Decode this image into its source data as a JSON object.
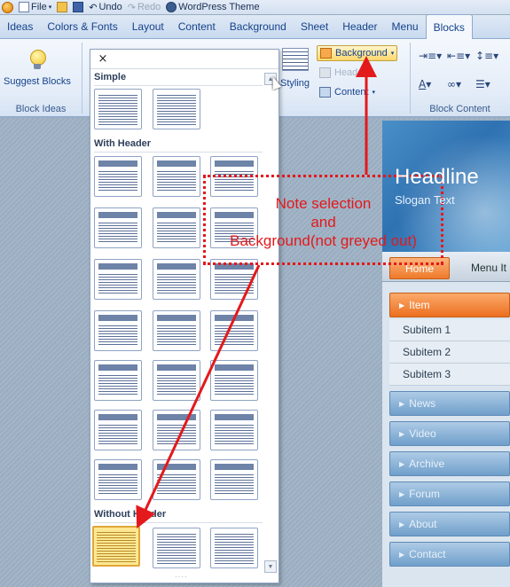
{
  "quick_access": {
    "file": "File",
    "undo": "Undo",
    "redo": "Redo",
    "theme": "WordPress Theme"
  },
  "tabs": [
    "Ideas",
    "Colors & Fonts",
    "Layout",
    "Content",
    "Background",
    "Sheet",
    "Header",
    "Menu",
    "Blocks"
  ],
  "ribbon": {
    "suggest_blocks": "Suggest Blocks",
    "block_ideas_label": "Block Ideas",
    "styling": "Styling",
    "background": "Background",
    "header": "Header",
    "content": "Content",
    "block_content_label": "Block Content"
  },
  "gallery": {
    "close": "×",
    "sections": {
      "simple": "Simple",
      "with_header": "With Header",
      "without_header": "Without Header"
    }
  },
  "site": {
    "headline": "Headline",
    "slogan": "Slogan Text",
    "nav_home": "Home",
    "nav_menu": "Menu It",
    "menu": {
      "item": "Item",
      "subitems": [
        "Subitem 1",
        "Subitem 2",
        "Subitem 3"
      ],
      "others": [
        "News",
        "Video",
        "Archive",
        "Forum",
        "About",
        "Contact"
      ]
    }
  },
  "annotation": {
    "line1": "Note selection",
    "line2": "and",
    "line3": "Background(not greyed out)",
    "color": "#e3191b"
  },
  "colors": {
    "ribbon_text": "#15428b",
    "accent_orange": "#ef7a2a",
    "selection_gold": "#fde792"
  }
}
